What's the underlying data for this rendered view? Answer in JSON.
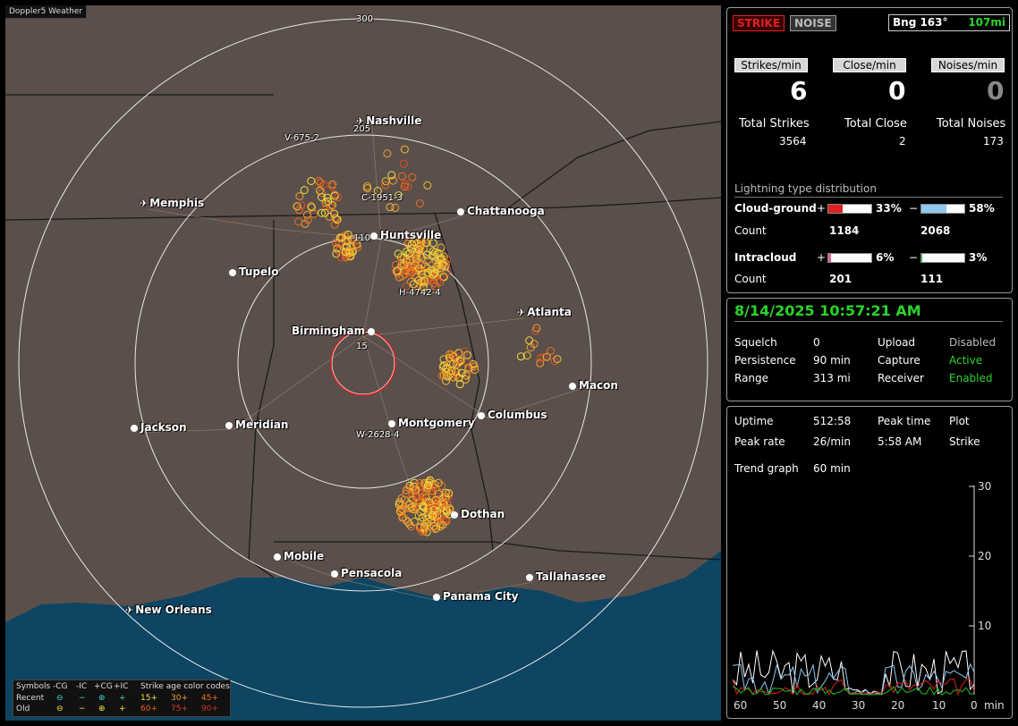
{
  "app_title": "Doppler5 Weather",
  "map": {
    "range_labels": [
      "300",
      "205",
      "110",
      "15"
    ],
    "cities": [
      {
        "name": "Nashville",
        "airport": true
      },
      {
        "name": "Memphis",
        "airport": true
      },
      {
        "name": "Chattanooga",
        "airport": false
      },
      {
        "name": "Huntsville",
        "airport": false
      },
      {
        "name": "Tupelo",
        "airport": false
      },
      {
        "name": "Atlanta",
        "airport": true
      },
      {
        "name": "Birmingham",
        "airport": false
      },
      {
        "name": "Macon",
        "airport": false
      },
      {
        "name": "Jackson",
        "airport": false
      },
      {
        "name": "Meridian",
        "airport": false
      },
      {
        "name": "Montgomery",
        "airport": false
      },
      {
        "name": "Columbus",
        "airport": false
      },
      {
        "name": "Dothan",
        "airport": false
      },
      {
        "name": "Mobile",
        "airport": false
      },
      {
        "name": "Pensacola",
        "airport": false
      },
      {
        "name": "Tallahassee",
        "airport": false
      },
      {
        "name": "Panama City",
        "airport": false
      },
      {
        "name": "New Orleans",
        "airport": true
      }
    ],
    "storm_labels": [
      "V-675-2",
      "C-1951-3",
      "H-4742-4",
      "W-2628-4"
    ],
    "legend": {
      "symbols_label": "Symbols",
      "recent_label": "Recent",
      "old_label": "Old",
      "cols": [
        "-CG",
        "-IC",
        "+CG",
        "+IC"
      ],
      "age_title": "Strike age color codes",
      "recent_ages": [
        "15+",
        "30+",
        "45+"
      ],
      "old_ages": [
        "60+",
        "75+",
        "90+"
      ]
    }
  },
  "top": {
    "strike_btn": "STRIKE",
    "noise_btn": "NOISE",
    "bearing": "Bng 163°",
    "distance": "107mi",
    "headers": [
      "Strikes/min",
      "Close/min",
      "Noises/min"
    ],
    "values": [
      "6",
      "0",
      "0"
    ],
    "total_labels": [
      "Total Strikes",
      "Total Close",
      "Total Noises"
    ],
    "totals": [
      "3564",
      "2",
      "173"
    ],
    "dist_title": "Lightning type distribution",
    "cg_label": "Cloud-ground",
    "ic_label": "Intracloud",
    "count_label": "Count",
    "cg_pos_pct": "33%",
    "cg_neg_pct": "58%",
    "cg_pos_count": "1184",
    "cg_neg_count": "2068",
    "ic_pos_pct": "6%",
    "ic_neg_pct": "3%",
    "ic_pos_count": "201",
    "ic_neg_count": "111",
    "cg_pos_fill": 0.33,
    "cg_neg_fill": 0.58,
    "ic_pos_fill": 0.06,
    "ic_neg_fill": 0.03
  },
  "status": {
    "datetime": "8/14/2025 10:57:21 AM",
    "rows": [
      {
        "k1": "Squelch",
        "v1": "0",
        "k2": "Upload",
        "v2": "Disabled"
      },
      {
        "k1": "Persistence",
        "v1": "90 min",
        "k2": "Capture",
        "v2": "Active"
      },
      {
        "k1": "Range",
        "v1": "313 mi",
        "k2": "Receiver",
        "v2": "Enabled"
      }
    ]
  },
  "trend": {
    "uptime_label": "Uptime",
    "uptime": "512:58",
    "peak_time_label": "Peak time",
    "plot_label": "Plot",
    "peak_rate_label": "Peak rate",
    "peak_rate": "26/min",
    "peak_time": "5:58 AM",
    "plot": "Strike",
    "graph_label": "Trend graph",
    "graph_span": "60 min",
    "y_ticks": [
      "30",
      "20",
      "10"
    ],
    "x_ticks": [
      "60",
      "50",
      "40",
      "30",
      "20",
      "10",
      "0",
      "min"
    ]
  },
  "colors": {
    "accent_green": "#2bd42b",
    "strike_red": "#e02020",
    "neg_blue": "#8ec8f0",
    "ic_pink": "#e060a0",
    "ic_green": "#20c020"
  }
}
